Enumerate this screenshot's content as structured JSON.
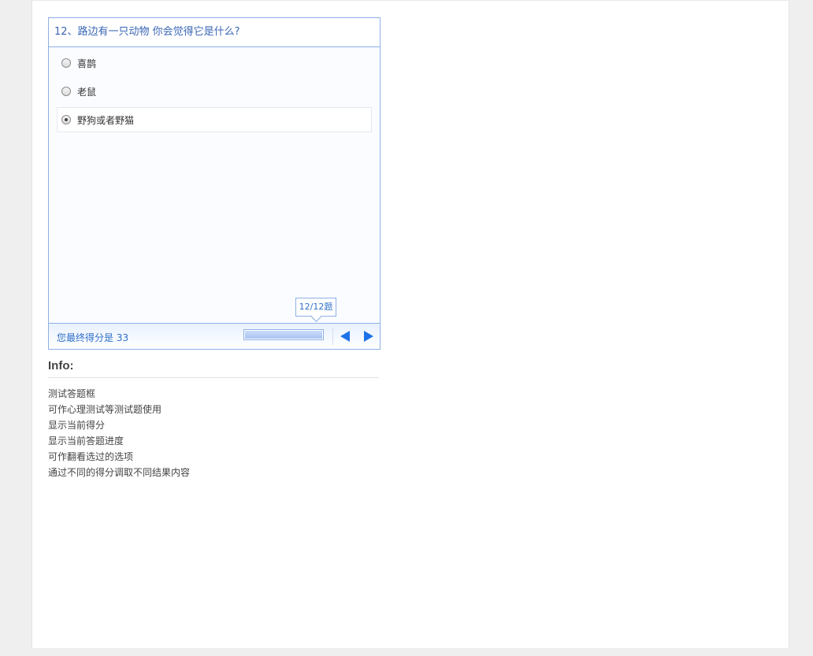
{
  "quiz": {
    "question": "12、路边有一只动物 你会觉得它是什么?",
    "options": [
      {
        "label": "喜鹊",
        "selected": false
      },
      {
        "label": "老鼠",
        "selected": false
      },
      {
        "label": "野狗或者野猫",
        "selected": true
      }
    ],
    "score_text": "您最终得分是 33",
    "progress_label": "12/12题",
    "progress_fraction": 1.0
  },
  "info": {
    "title": "Info:",
    "lines": [
      "测试答题框",
      "可作心理测试等测试题使用",
      "显示当前得分",
      "显示当前答题进度",
      "可作翻看选过的选项",
      "通过不同的得分调取不同结果内容"
    ]
  },
  "icons": {
    "prev": "arrow-left-icon",
    "next": "arrow-right-icon"
  },
  "colors": {
    "accent": "#1d72e8",
    "border": "#8eb0e6",
    "text_blue": "#2f6fc8"
  }
}
